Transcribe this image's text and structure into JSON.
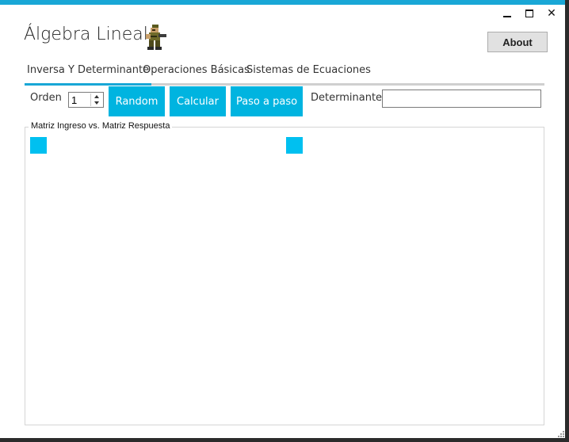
{
  "window": {
    "title": "Álgebra Lineal",
    "controls": {
      "minimize_icon": "minimize-icon",
      "maximize_icon": "maximize-icon",
      "close_glyph": "✕"
    }
  },
  "header": {
    "about_label": "About"
  },
  "tabs": [
    {
      "label": "Inversa Y Determinante",
      "active": true
    },
    {
      "label": "Operaciones Básicas",
      "active": false
    },
    {
      "label": "Sistemas de Ecuaciones",
      "active": false
    }
  ],
  "toolbar": {
    "order_label": "Orden",
    "order_value": "1",
    "random_label": "Random",
    "calc_label": "Calcular",
    "step_label": "Paso a paso",
    "det_label": "Determinante",
    "det_value": ""
  },
  "matrix_group": {
    "title": "Matriz Ingreso vs. Matriz Respuesta"
  },
  "colors": {
    "accent": "#19a7d6",
    "button": "#00b4e0",
    "cell": "#00c0f0"
  }
}
